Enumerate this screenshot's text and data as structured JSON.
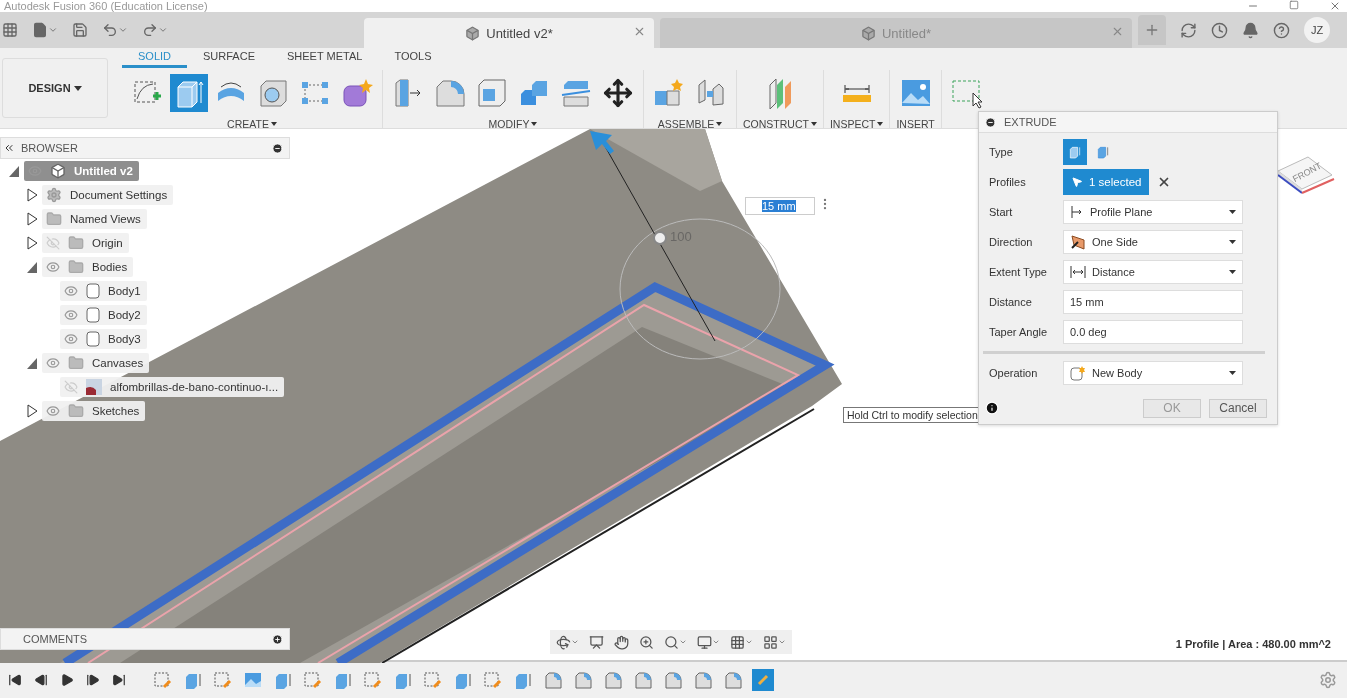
{
  "title_bar": {
    "title": "Autodesk Fusion 360 (Education License)"
  },
  "document_tabs": [
    {
      "label": "Untitled v2*",
      "selected": true
    },
    {
      "label": "Untitled*",
      "selected": false
    }
  ],
  "user": {
    "initials": "JZ"
  },
  "workspace": {
    "label": "DESIGN"
  },
  "ribbon_tabs": [
    {
      "label": "SOLID",
      "selected": true
    },
    {
      "label": "SURFACE",
      "selected": false
    },
    {
      "label": "SHEET METAL",
      "selected": false
    },
    {
      "label": "TOOLS",
      "selected": false
    }
  ],
  "ribbon_groups": [
    {
      "label": "CREATE",
      "dropdown": true,
      "tools": [
        {
          "kind": "sketch",
          "selected": false
        },
        {
          "kind": "extrude",
          "selected": true
        },
        {
          "kind": "revolve",
          "selected": false
        },
        {
          "kind": "hole",
          "selected": false
        },
        {
          "kind": "pattern",
          "selected": false
        },
        {
          "kind": "form",
          "selected": false
        }
      ]
    },
    {
      "label": "MODIFY",
      "dropdown": true,
      "tools": [
        {
          "kind": "presspull",
          "selected": false
        },
        {
          "kind": "fillet",
          "selected": false
        },
        {
          "kind": "shell",
          "selected": false
        },
        {
          "kind": "combine",
          "selected": false
        },
        {
          "kind": "split",
          "selected": false
        },
        {
          "kind": "move",
          "selected": false
        }
      ]
    },
    {
      "label": "ASSEMBLE",
      "dropdown": true,
      "tools": [
        {
          "kind": "component",
          "selected": false
        },
        {
          "kind": "joint",
          "selected": false
        }
      ]
    },
    {
      "label": "CONSTRUCT",
      "dropdown": true,
      "tools": [
        {
          "kind": "plane",
          "selected": false
        }
      ]
    },
    {
      "label": "INSPECT",
      "dropdown": true,
      "tools": [
        {
          "kind": "measure",
          "selected": false
        }
      ]
    },
    {
      "label": "INSERT",
      "dropdown": false,
      "tools": [
        {
          "kind": "image",
          "selected": false
        }
      ]
    },
    {
      "tools": [
        {
          "kind": "select",
          "selected": false
        }
      ]
    }
  ],
  "browser": {
    "title": "BROWSER",
    "tree": [
      {
        "label": "Untitled v2",
        "kind": "component",
        "visible": true,
        "expanded": true,
        "active": true,
        "children": [
          {
            "label": "Document Settings",
            "kind": "settings",
            "expanded": false,
            "active": false
          },
          {
            "label": "Named Views",
            "kind": "folder",
            "expanded": false,
            "active": false
          },
          {
            "label": "Origin",
            "kind": "folder",
            "visible": false,
            "expanded": false,
            "active": false
          },
          {
            "label": "Bodies",
            "kind": "folder",
            "visible": true,
            "expanded": true,
            "active": false,
            "children": [
              {
                "label": "Body1",
                "kind": "body",
                "visible": true,
                "active": false
              },
              {
                "label": "Body2",
                "kind": "body",
                "visible": true,
                "active": false
              },
              {
                "label": "Body3",
                "kind": "body",
                "visible": true,
                "active": false
              }
            ]
          },
          {
            "label": "Canvases",
            "kind": "folder",
            "visible": true,
            "expanded": true,
            "active": false,
            "children": [
              {
                "label": "alfombrillas-de-bano-continuo-ı...",
                "kind": "canvas",
                "visible": false,
                "active": false
              }
            ]
          },
          {
            "label": "Sketches",
            "kind": "sketches",
            "visible": true,
            "expanded": false,
            "active": false
          }
        ]
      }
    ]
  },
  "comments": {
    "title": "COMMENTS"
  },
  "viewport": {
    "dimension_input": "15 mm",
    "manipulator_label": "100",
    "viewcube_face": "FRONT",
    "tooltip": "Hold Ctrl to modify selection"
  },
  "extrude": {
    "title": "EXTRUDE",
    "rows": [
      {
        "kind": "type",
        "label": "Type",
        "options": [
          {
            "selected": true
          },
          {
            "selected": false
          }
        ]
      },
      {
        "kind": "selection",
        "label": "Profiles",
        "value": "1 selected"
      },
      {
        "kind": "dropdown",
        "label": "Start",
        "value": "Profile Plane"
      },
      {
        "kind": "dropdown",
        "label": "Direction",
        "value": "One Side"
      },
      {
        "kind": "dropdown",
        "label": "Extent Type",
        "value": "Distance"
      },
      {
        "kind": "input",
        "label": "Distance",
        "value": "15 mm"
      },
      {
        "kind": "input",
        "label": "Taper Angle",
        "value": "0.0 deg"
      },
      {
        "kind": "separator"
      },
      {
        "kind": "dropdown",
        "label": "Operation",
        "value": "New Body"
      }
    ],
    "buttons": [
      {
        "label": "OK",
        "disabled": true
      },
      {
        "label": "Cancel",
        "disabled": false
      }
    ]
  },
  "status": {
    "text": "1 Profile | Area : 480.00 mm^2"
  },
  "timeline": {
    "items": [
      {
        "kind": "sketch",
        "selected": false
      },
      {
        "kind": "extrude",
        "selected": false
      },
      {
        "kind": "sketch",
        "selected": false
      },
      {
        "kind": "canvas",
        "selected": false
      },
      {
        "kind": "extrude",
        "selected": false
      },
      {
        "kind": "sketch",
        "selected": false
      },
      {
        "kind": "extrude",
        "selected": false
      },
      {
        "kind": "sketch",
        "selected": false
      },
      {
        "kind": "extrude",
        "selected": false
      },
      {
        "kind": "sketch",
        "selected": false
      },
      {
        "kind": "extrude",
        "selected": false
      },
      {
        "kind": "sketch",
        "selected": false
      },
      {
        "kind": "extrude",
        "selected": false
      },
      {
        "kind": "fillet",
        "selected": false
      },
      {
        "kind": "fillet",
        "selected": false
      },
      {
        "kind": "fillet",
        "selected": false
      },
      {
        "kind": "fillet",
        "selected": false
      },
      {
        "kind": "fillet",
        "selected": false
      },
      {
        "kind": "fillet",
        "selected": false
      },
      {
        "kind": "fillet",
        "selected": false
      },
      {
        "kind": "sketch",
        "selected": true
      }
    ]
  }
}
